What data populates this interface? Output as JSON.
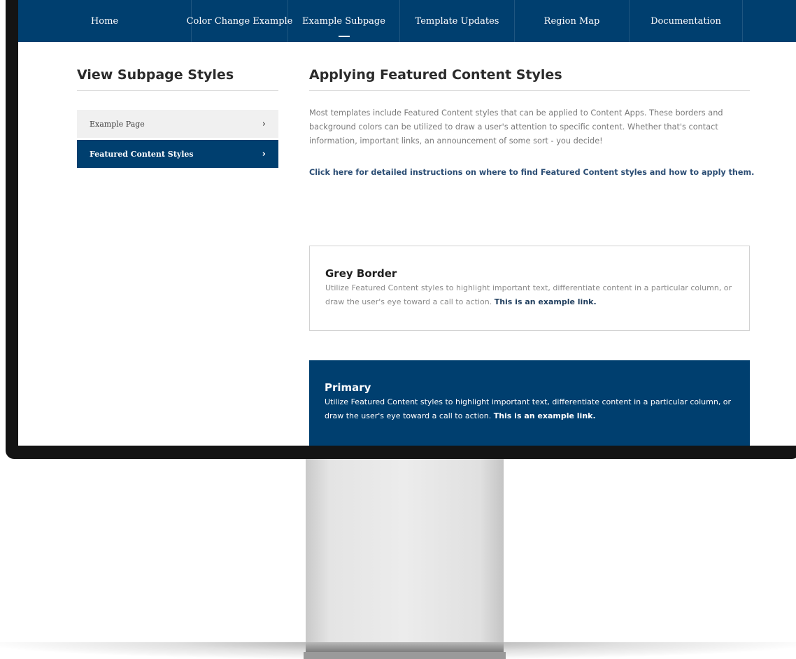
{
  "nav": {
    "items": [
      {
        "label": "Home",
        "active": false
      },
      {
        "label": "Color Change Example",
        "active": false
      },
      {
        "label": "Example Subpage",
        "active": true
      },
      {
        "label": "Template Updates",
        "active": false
      },
      {
        "label": "Region Map",
        "active": false
      },
      {
        "label": "Documentation",
        "active": false
      }
    ]
  },
  "sidebar": {
    "title": "View Subpage Styles",
    "items": [
      {
        "label": "Example Page",
        "chevron": "›",
        "active": false
      },
      {
        "label": "Featured Content Styles",
        "chevron": "›",
        "active": true
      }
    ]
  },
  "main": {
    "title": "Applying Featured Content Styles",
    "intro": "Most templates include Featured Content styles that can be applied to Content Apps. These borders and background colors can be utilized to draw a user's attention to specific content. Whether that's contact information, important links, an announcement of some sort - you decide!",
    "instructions_link": "Click here for detailed instructions on where to find Featured Content styles and how to apply them.",
    "cards": [
      {
        "title": "Grey Border",
        "body": "Utilize Featured Content styles to highlight important text, differentiate content in a particular column, or draw the user's eye toward a call to action.",
        "link": "This is an example link."
      },
      {
        "title": "Primary",
        "body": "Utilize Featured Content styles to highlight important text, differentiate content in a particular column, or draw the user's eye toward a call to action.",
        "link": "This is an example link."
      }
    ]
  },
  "colors": {
    "primary": "#003f6f",
    "sidebar_item_bg": "#f0f0f0",
    "link": "#2b4d74"
  }
}
